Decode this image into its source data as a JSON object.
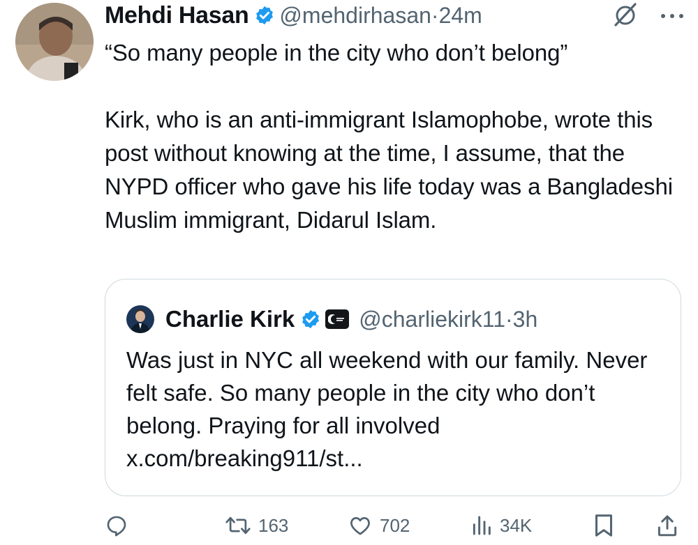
{
  "author": {
    "name": "Mehdi Hasan",
    "handle": "@mehdirhasan",
    "separator": "·",
    "time": "24m"
  },
  "tweet_text": "“So many people in the city who don’t belong”\n\nKirk, who is an anti-immigrant Islamophobe, wrote this post without knowing at the time, I assume, that the NYPD officer who gave his life today was a Bangladeshi Muslim immigrant, Didarul Islam.",
  "quoted": {
    "name": "Charlie Kirk",
    "handle": "@charliekirk11",
    "separator": "·",
    "time": "3h",
    "text": "Was just in NYC all weekend with our family. Never felt safe. So many people in the city who don’t belong. Praying for all involved x.com/breaking911/st..."
  },
  "actions": {
    "reposts": "163",
    "likes": "702",
    "views": "34K"
  },
  "icons": [
    "verified-badge-icon",
    "grok-icon",
    "more-options-icon",
    "affiliate-badge-icon",
    "reply-icon",
    "repost-icon",
    "like-icon",
    "views-icon",
    "bookmark-icon",
    "share-icon"
  ],
  "colors": {
    "text": "#0f1419",
    "secondary": "#536471",
    "verified_blue": "#1d9bf0",
    "border": "#cfd9de"
  }
}
